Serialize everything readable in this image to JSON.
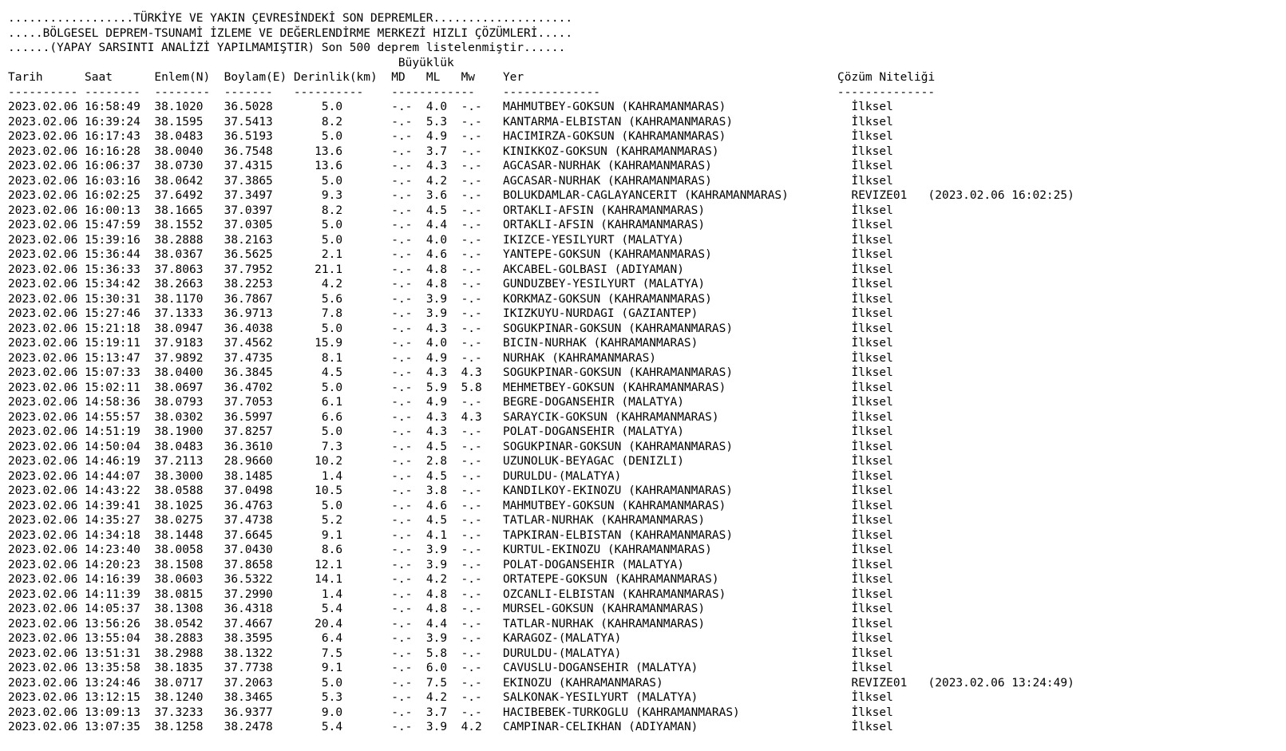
{
  "header": {
    "title_line": "..................TÜRKİYE VE YAKIN ÇEVRESİNDEKİ SON DEPREMLER....................",
    "org_line": ".....BÖLGESEL DEPREM-TSUNAMİ İZLEME VE DEĞERLENDİRME MERKEZİ HIZLI ÇÖZÜMLERİ.....",
    "note_line": "......(YAPAY SARSINTI ANALİZİ YAPILMAMIŞTIR) Son 500 deprem listelenmiştir......"
  },
  "columns": {
    "magnitude_group": "Büyüklük",
    "date": "Tarih",
    "time": "Saat",
    "lat": "Enlem(N)",
    "lon": "Boylam(E)",
    "depth": "Derinlik(km)",
    "md": "MD",
    "ml": "ML",
    "mw": "Mw",
    "place": "Yer",
    "quality": "Çözüm Niteliği"
  },
  "rows": [
    [
      "2023.02.06",
      "16:58:49",
      "38.1020",
      "36.5028",
      "5.0",
      "-.-",
      "4.0",
      "-.-",
      "MAHMUTBEY-GOKSUN (KAHRAMANMARAS)",
      "İlksel",
      ""
    ],
    [
      "2023.02.06",
      "16:39:24",
      "38.1595",
      "37.5413",
      "8.2",
      "-.-",
      "5.3",
      "-.-",
      "KANTARMA-ELBISTAN (KAHRAMANMARAS)",
      "İlksel",
      ""
    ],
    [
      "2023.02.06",
      "16:17:43",
      "38.0483",
      "36.5193",
      "5.0",
      "-.-",
      "4.9",
      "-.-",
      "HACIMIRZA-GOKSUN (KAHRAMANMARAS)",
      "İlksel",
      ""
    ],
    [
      "2023.02.06",
      "16:16:28",
      "38.0040",
      "36.7548",
      "13.6",
      "-.-",
      "3.7",
      "-.-",
      "KINIKKOZ-GOKSUN (KAHRAMANMARAS)",
      "İlksel",
      ""
    ],
    [
      "2023.02.06",
      "16:06:37",
      "38.0730",
      "37.4315",
      "13.6",
      "-.-",
      "4.3",
      "-.-",
      "AGCASAR-NURHAK (KAHRAMANMARAS)",
      "İlksel",
      ""
    ],
    [
      "2023.02.06",
      "16:03:16",
      "38.0642",
      "37.3865",
      "5.0",
      "-.-",
      "4.2",
      "-.-",
      "AGCASAR-NURHAK (KAHRAMANMARAS)",
      "İlksel",
      ""
    ],
    [
      "2023.02.06",
      "16:02:25",
      "37.6492",
      "37.3497",
      "9.3",
      "-.-",
      "3.6",
      "-.-",
      "BOLUKDAMLAR-CAGLAYANCERIT (KAHRAMANMARAS)",
      "REVIZE01",
      "(2023.02.06 16:02:25)"
    ],
    [
      "2023.02.06",
      "16:00:13",
      "38.1665",
      "37.0397",
      "8.2",
      "-.-",
      "4.5",
      "-.-",
      "ORTAKLI-AFSIN (KAHRAMANMARAS)",
      "İlksel",
      ""
    ],
    [
      "2023.02.06",
      "15:47:59",
      "38.1552",
      "37.0305",
      "5.0",
      "-.-",
      "4.4",
      "-.-",
      "ORTAKLI-AFSIN (KAHRAMANMARAS)",
      "İlksel",
      ""
    ],
    [
      "2023.02.06",
      "15:39:16",
      "38.2888",
      "38.2163",
      "5.0",
      "-.-",
      "4.0",
      "-.-",
      "IKIZCE-YESILYURT (MALATYA)",
      "İlksel",
      ""
    ],
    [
      "2023.02.06",
      "15:36:44",
      "38.0367",
      "36.5625",
      "2.1",
      "-.-",
      "4.6",
      "-.-",
      "YANTEPE-GOKSUN (KAHRAMANMARAS)",
      "İlksel",
      ""
    ],
    [
      "2023.02.06",
      "15:36:33",
      "37.8063",
      "37.7952",
      "21.1",
      "-.-",
      "4.8",
      "-.-",
      "AKCABEL-GOLBASI (ADIYAMAN)",
      "İlksel",
      ""
    ],
    [
      "2023.02.06",
      "15:34:42",
      "38.2663",
      "38.2253",
      "4.2",
      "-.-",
      "4.8",
      "-.-",
      "GUNDUZBEY-YESILYURT (MALATYA)",
      "İlksel",
      ""
    ],
    [
      "2023.02.06",
      "15:30:31",
      "38.1170",
      "36.7867",
      "5.6",
      "-.-",
      "3.9",
      "-.-",
      "KORKMAZ-GOKSUN (KAHRAMANMARAS)",
      "İlksel",
      ""
    ],
    [
      "2023.02.06",
      "15:27:46",
      "37.1333",
      "36.9713",
      "7.8",
      "-.-",
      "3.9",
      "-.-",
      "IKIZKUYU-NURDAGI (GAZIANTEP)",
      "İlksel",
      ""
    ],
    [
      "2023.02.06",
      "15:21:18",
      "38.0947",
      "36.4038",
      "5.0",
      "-.-",
      "4.3",
      "-.-",
      "SOGUKPINAR-GOKSUN (KAHRAMANMARAS)",
      "İlksel",
      ""
    ],
    [
      "2023.02.06",
      "15:19:11",
      "37.9183",
      "37.4562",
      "15.9",
      "-.-",
      "4.0",
      "-.-",
      "BICIN-NURHAK (KAHRAMANMARAS)",
      "İlksel",
      ""
    ],
    [
      "2023.02.06",
      "15:13:47",
      "37.9892",
      "37.4735",
      "8.1",
      "-.-",
      "4.9",
      "-.-",
      "NURHAK (KAHRAMANMARAS)",
      "İlksel",
      ""
    ],
    [
      "2023.02.06",
      "15:07:33",
      "38.0400",
      "36.3845",
      "4.5",
      "-.-",
      "4.3",
      "4.3",
      "SOGUKPINAR-GOKSUN (KAHRAMANMARAS)",
      "İlksel",
      ""
    ],
    [
      "2023.02.06",
      "15:02:11",
      "38.0697",
      "36.4702",
      "5.0",
      "-.-",
      "5.9",
      "5.8",
      "MEHMETBEY-GOKSUN (KAHRAMANMARAS)",
      "İlksel",
      ""
    ],
    [
      "2023.02.06",
      "14:58:36",
      "38.0793",
      "37.7053",
      "6.1",
      "-.-",
      "4.9",
      "-.-",
      "BEGRE-DOGANSEHIR (MALATYA)",
      "İlksel",
      ""
    ],
    [
      "2023.02.06",
      "14:55:57",
      "38.0302",
      "36.5997",
      "6.6",
      "-.-",
      "4.3",
      "4.3",
      "SARAYCIK-GOKSUN (KAHRAMANMARAS)",
      "İlksel",
      ""
    ],
    [
      "2023.02.06",
      "14:51:19",
      "38.1900",
      "37.8257",
      "5.0",
      "-.-",
      "4.3",
      "-.-",
      "POLAT-DOGANSEHIR (MALATYA)",
      "İlksel",
      ""
    ],
    [
      "2023.02.06",
      "14:50:04",
      "38.0483",
      "36.3610",
      "7.3",
      "-.-",
      "4.5",
      "-.-",
      "SOGUKPINAR-GOKSUN (KAHRAMANMARAS)",
      "İlksel",
      ""
    ],
    [
      "2023.02.06",
      "14:46:19",
      "37.2113",
      "28.9660",
      "10.2",
      "-.-",
      "2.8",
      "-.-",
      "UZUNOLUK-BEYAGAC (DENIZLI)",
      "İlksel",
      ""
    ],
    [
      "2023.02.06",
      "14:44:07",
      "38.3000",
      "38.1485",
      "1.4",
      "-.-",
      "4.5",
      "-.-",
      "DURULDU-(MALATYA)",
      "İlksel",
      ""
    ],
    [
      "2023.02.06",
      "14:43:22",
      "38.0588",
      "37.0498",
      "10.5",
      "-.-",
      "3.8",
      "-.-",
      "KANDILKOY-EKINOZU (KAHRAMANMARAS)",
      "İlksel",
      ""
    ],
    [
      "2023.02.06",
      "14:39:41",
      "38.1025",
      "36.4763",
      "5.0",
      "-.-",
      "4.6",
      "-.-",
      "MAHMUTBEY-GOKSUN (KAHRAMANMARAS)",
      "İlksel",
      ""
    ],
    [
      "2023.02.06",
      "14:35:27",
      "38.0275",
      "37.4738",
      "5.2",
      "-.-",
      "4.5",
      "-.-",
      "TATLAR-NURHAK (KAHRAMANMARAS)",
      "İlksel",
      ""
    ],
    [
      "2023.02.06",
      "14:34:18",
      "38.1448",
      "37.6645",
      "9.1",
      "-.-",
      "4.1",
      "-.-",
      "TAPKIRAN-ELBISTAN (KAHRAMANMARAS)",
      "İlksel",
      ""
    ],
    [
      "2023.02.06",
      "14:23:40",
      "38.0058",
      "37.0430",
      "8.6",
      "-.-",
      "3.9",
      "-.-",
      "KURTUL-EKINOZU (KAHRAMANMARAS)",
      "İlksel",
      ""
    ],
    [
      "2023.02.06",
      "14:20:23",
      "38.1508",
      "37.8658",
      "12.1",
      "-.-",
      "3.9",
      "-.-",
      "POLAT-DOGANSEHIR (MALATYA)",
      "İlksel",
      ""
    ],
    [
      "2023.02.06",
      "14:16:39",
      "38.0603",
      "36.5322",
      "14.1",
      "-.-",
      "4.2",
      "-.-",
      "ORTATEPE-GOKSUN (KAHRAMANMARAS)",
      "İlksel",
      ""
    ],
    [
      "2023.02.06",
      "14:11:39",
      "38.0815",
      "37.2990",
      "1.4",
      "-.-",
      "4.8",
      "-.-",
      "OZCANLI-ELBISTAN (KAHRAMANMARAS)",
      "İlksel",
      ""
    ],
    [
      "2023.02.06",
      "14:05:37",
      "38.1308",
      "36.4318",
      "5.4",
      "-.-",
      "4.8",
      "-.-",
      "MURSEL-GOKSUN (KAHRAMANMARAS)",
      "İlksel",
      ""
    ],
    [
      "2023.02.06",
      "13:56:26",
      "38.0542",
      "37.4667",
      "20.4",
      "-.-",
      "4.4",
      "-.-",
      "TATLAR-NURHAK (KAHRAMANMARAS)",
      "İlksel",
      ""
    ],
    [
      "2023.02.06",
      "13:55:04",
      "38.2883",
      "38.3595",
      "6.4",
      "-.-",
      "3.9",
      "-.-",
      "KARAGOZ-(MALATYA)",
      "İlksel",
      ""
    ],
    [
      "2023.02.06",
      "13:51:31",
      "38.2988",
      "38.1322",
      "7.5",
      "-.-",
      "5.8",
      "-.-",
      "DURULDU-(MALATYA)",
      "İlksel",
      ""
    ],
    [
      "2023.02.06",
      "13:35:58",
      "38.1835",
      "37.7738",
      "9.1",
      "-.-",
      "6.0",
      "-.-",
      "CAVUSLU-DOGANSEHIR (MALATYA)",
      "İlksel",
      ""
    ],
    [
      "2023.02.06",
      "13:24:46",
      "38.0717",
      "37.2063",
      "5.0",
      "-.-",
      "7.5",
      "-.-",
      "EKINOZU (KAHRAMANMARAS)",
      "REVIZE01",
      "(2023.02.06 13:24:49)"
    ],
    [
      "2023.02.06",
      "13:12:15",
      "38.1240",
      "38.3465",
      "5.3",
      "-.-",
      "4.2",
      "-.-",
      "SALKONAK-YESILYURT (MALATYA)",
      "İlksel",
      ""
    ],
    [
      "2023.02.06",
      "13:09:13",
      "37.3233",
      "36.9377",
      "9.0",
      "-.-",
      "3.7",
      "-.-",
      "HACIBEBEK-TURKOGLU (KAHRAMANMARAS)",
      "İlksel",
      ""
    ],
    [
      "2023.02.06",
      "13:07:35",
      "38.1258",
      "38.2478",
      "5.4",
      "-.-",
      "3.9",
      "4.2",
      "CAMPINAR-CELIKHAN (ADIYAMAN)",
      "İlksel",
      ""
    ]
  ]
}
